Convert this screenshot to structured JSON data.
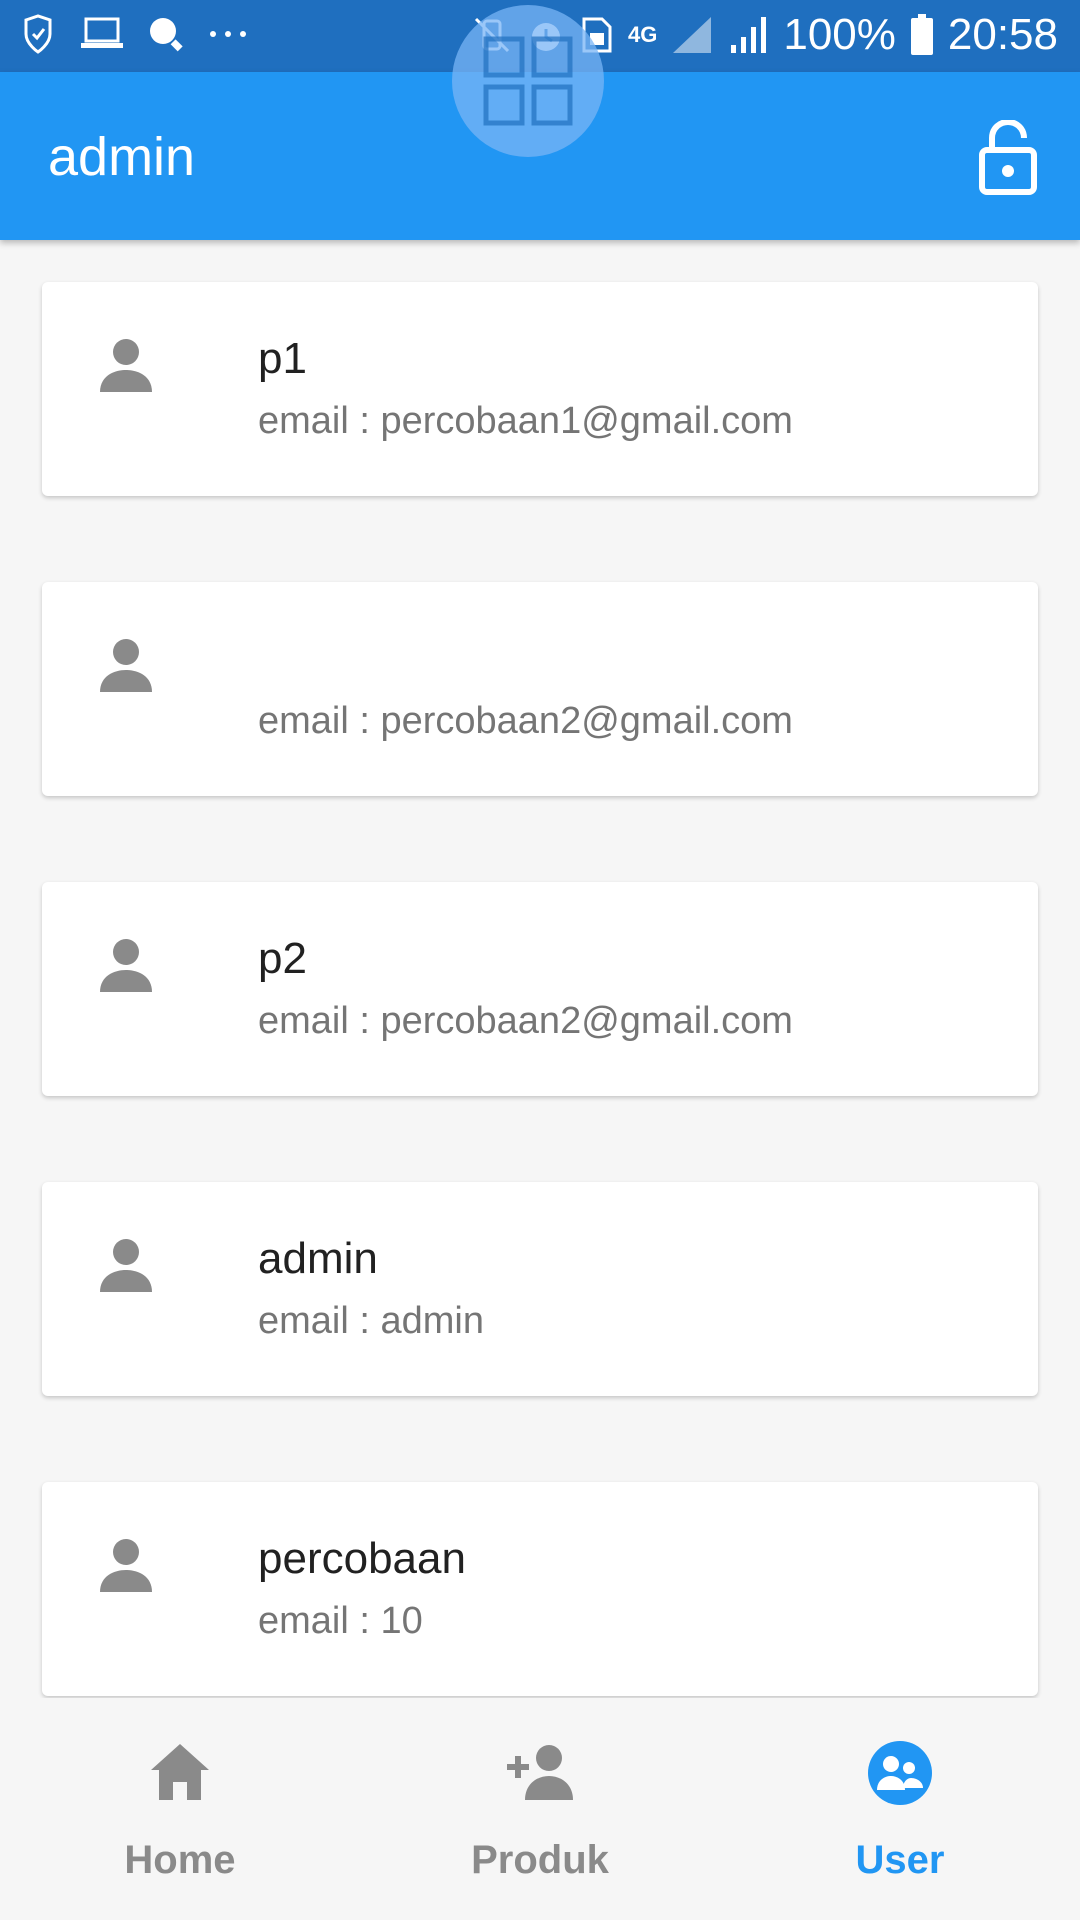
{
  "status_bar": {
    "battery": "100%",
    "time": "20:58",
    "network": "4G"
  },
  "app_bar": {
    "title": "admin"
  },
  "users": [
    {
      "name": "p1",
      "email": "email : percobaan1@gmail.com"
    },
    {
      "name": "",
      "email": "email : percobaan2@gmail.com"
    },
    {
      "name": "p2",
      "email": "email : percobaan2@gmail.com"
    },
    {
      "name": "admin",
      "email": "email : admin"
    },
    {
      "name": "percobaan",
      "email": "email : 10"
    }
  ],
  "bottom_nav": {
    "items": [
      {
        "label": "Home",
        "icon": "home-icon"
      },
      {
        "label": "Produk",
        "icon": "person-add-icon"
      },
      {
        "label": "User",
        "icon": "users-icon",
        "active": true
      }
    ]
  },
  "colors": {
    "primary": "#2196f3",
    "status_bar": "#1f6fbf",
    "inactive": "#8a8a8a"
  }
}
